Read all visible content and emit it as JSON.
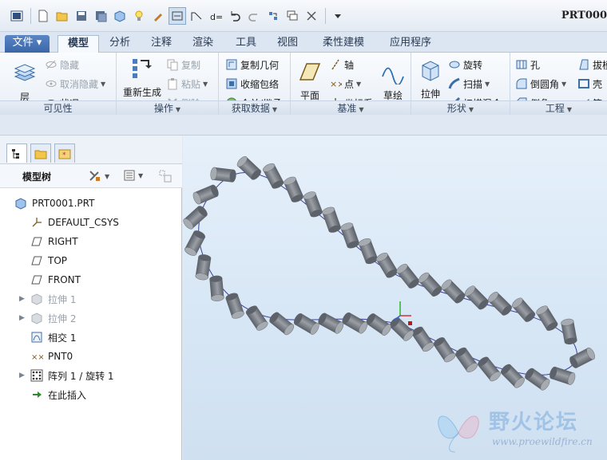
{
  "window": {
    "title": "PRT000"
  },
  "tabs": [
    {
      "label": "文件 ▾"
    },
    {
      "label": "模型"
    },
    {
      "label": "分析"
    },
    {
      "label": "注释"
    },
    {
      "label": "渲染"
    },
    {
      "label": "工具"
    },
    {
      "label": "视图"
    },
    {
      "label": "柔性建模"
    },
    {
      "label": "应用程序"
    }
  ],
  "ribbon": {
    "visibility": {
      "layer": "层",
      "hide": "隐藏",
      "unhide": "取消隐藏",
      "status": "状况",
      "group": "可见性"
    },
    "operations": {
      "regenerate": "重新生成",
      "copy": "复制",
      "paste": "粘贴",
      "delete": "删除",
      "group": "操作"
    },
    "getdata": {
      "copy_geom": "复制几何",
      "shrinkwrap": "收缩包络",
      "merge": "合并/继承",
      "group": "获取数据"
    },
    "datum": {
      "plane": "平面",
      "axis": "轴",
      "point": "点",
      "csys": "坐标系",
      "sketch": "草绘",
      "group": "基准"
    },
    "shapes": {
      "extrude": "拉伸",
      "revolve": "旋转",
      "sweep": "扫描",
      "swept_blend": "扫描混合",
      "group": "形状"
    },
    "engineering": {
      "hole": "孔",
      "round": "倒圆角",
      "chamfer": "倒角",
      "draft": "拔模",
      "shell": "壳",
      "rib": "筋",
      "group": "工程"
    }
  },
  "tree": {
    "title": "模型树",
    "items": [
      {
        "label": "PRT0001.PRT"
      },
      {
        "label": "DEFAULT_CSYS"
      },
      {
        "label": "RIGHT"
      },
      {
        "label": "TOP"
      },
      {
        "label": "FRONT"
      },
      {
        "label": "拉伸 1"
      },
      {
        "label": "拉伸 2"
      },
      {
        "label": "相交 1"
      },
      {
        "label": "PNT0"
      },
      {
        "label": "阵列 1 / 旋转 1"
      },
      {
        "label": "在此插入"
      }
    ]
  },
  "watermark": {
    "title": "野火论坛",
    "url": "www.proewildfire.cn"
  },
  "colors": {
    "accent": "#3b66a8",
    "cylinder": "#7c8088",
    "curve": "#3a3fa0"
  }
}
